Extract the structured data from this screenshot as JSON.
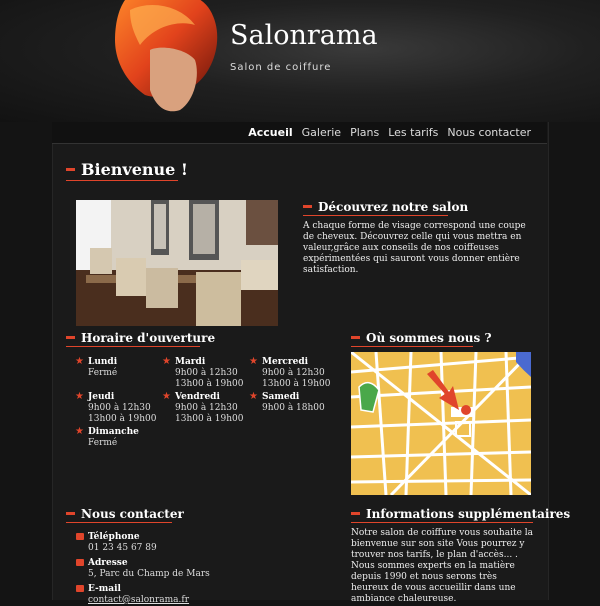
{
  "site": {
    "title": "Salonrama",
    "subtitle": "Salon de coiffure"
  },
  "nav": [
    "Accueil",
    "Galerie",
    "Plans",
    "Les tarifs",
    "Nous contacter"
  ],
  "welcome": {
    "title": "Bienvenue !"
  },
  "discover": {
    "title": "Découvrez notre salon",
    "text": "A chaque forme de visage correspond une coupe de cheveux. Découvrez celle qui vous mettra en valeur,grâce aux conseils de nos coiffeuses expérimentées qui sauront vous donner entière satisfaction."
  },
  "hours": {
    "title": "Horaire d'ouverture",
    "days": [
      {
        "day": "Lundi",
        "line1": "Fermé",
        "line2": ""
      },
      {
        "day": "Mardi",
        "line1": "9h00 à 12h30",
        "line2": "13h00 à 19h00"
      },
      {
        "day": "Mercredi",
        "line1": "9h00 à 12h30",
        "line2": "13h00 à 19h00"
      },
      {
        "day": "Jeudi",
        "line1": "9h00 à 12h30",
        "line2": "13h00 à 19h00"
      },
      {
        "day": "Vendredi",
        "line1": "9h00 à 12h30",
        "line2": "13h00 à 19h00"
      },
      {
        "day": "Samedi",
        "line1": "9h00 à 18h00",
        "line2": ""
      },
      {
        "day": "Dimanche",
        "line1": "Fermé",
        "line2": ""
      }
    ]
  },
  "location": {
    "title": "Où sommes nous ?"
  },
  "contact": {
    "title": "Nous contacter",
    "items": [
      {
        "label": "Téléphone",
        "value": "01 23 45 67 89"
      },
      {
        "label": "Adresse",
        "value": "5, Parc du Champ de Mars"
      },
      {
        "label": "E-mail",
        "value": "contact@salonrama.fr"
      }
    ]
  },
  "info": {
    "title": "Informations supplémentaires",
    "text": "Notre salon de coiffure vous souhaite la bienvenue sur son site Vous pourrez y trouver nos tarifs, le plan d'accès... . Nous sommes experts en la matière depuis 1990 et nous serons très heureux de vous accueillir dans une ambiance chaleureuse."
  },
  "colors": {
    "accent": "#e0452b",
    "background": "#141414",
    "panel": "#1a1a1a",
    "map_block": "#f0c050"
  }
}
